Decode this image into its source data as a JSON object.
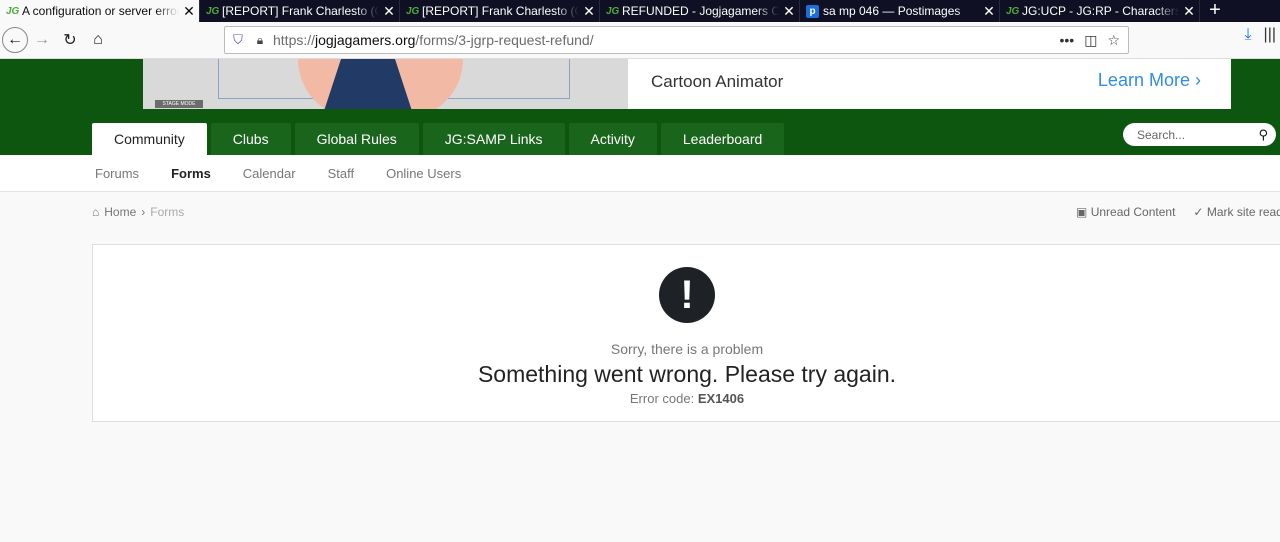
{
  "browser": {
    "tabs": [
      {
        "favicon": "JG",
        "title": "A configuration or server error",
        "active": true
      },
      {
        "favicon": "JG",
        "title": "[REPORT] Frank Charlesto (Car",
        "active": false
      },
      {
        "favicon": "JG",
        "title": "[REPORT] Frank Charlesto (Car",
        "active": false
      },
      {
        "favicon": "JG",
        "title": "REFUNDED - Jogjagamers Com",
        "active": false
      },
      {
        "favicon": "p",
        "title": "sa mp 046 — Postimages",
        "active": false
      },
      {
        "favicon": "JG",
        "title": "JG:UCP - JG:RP - Characters",
        "active": false
      }
    ],
    "tab_close_glyph": "✕",
    "new_tab_glyph": "+",
    "url_prefix": "https://",
    "url_domain": "jogjagamers.org",
    "url_path": "/forms/3-jgrp-request-refund/"
  },
  "ad": {
    "stage_label": "STAGE MODE",
    "title": "Cartoon Animator",
    "cta": "Learn More",
    "cta_icon": "chevron-right-icon"
  },
  "main_nav": [
    "Community",
    "Clubs",
    "Global Rules",
    "JG:SAMP Links",
    "Activity",
    "Leaderboard"
  ],
  "search": {
    "placeholder": "Search..."
  },
  "sub_nav": [
    "Forums",
    "Forms",
    "Calendar",
    "Staff",
    "Online Users"
  ],
  "breadcrumb": {
    "home": "Home",
    "current": "Forms"
  },
  "breadcrumb_tools": {
    "unread": "Unread Content",
    "mark_read": "Mark site read"
  },
  "error": {
    "sorry": "Sorry, there is a problem",
    "message": "Something went wrong. Please try again.",
    "code_label": "Error code:",
    "code": "EX1406"
  },
  "colors": {
    "header_green": "#0c5610",
    "nav_tab_green": "#1a651c",
    "ad_link_blue": "#2f8de4"
  }
}
